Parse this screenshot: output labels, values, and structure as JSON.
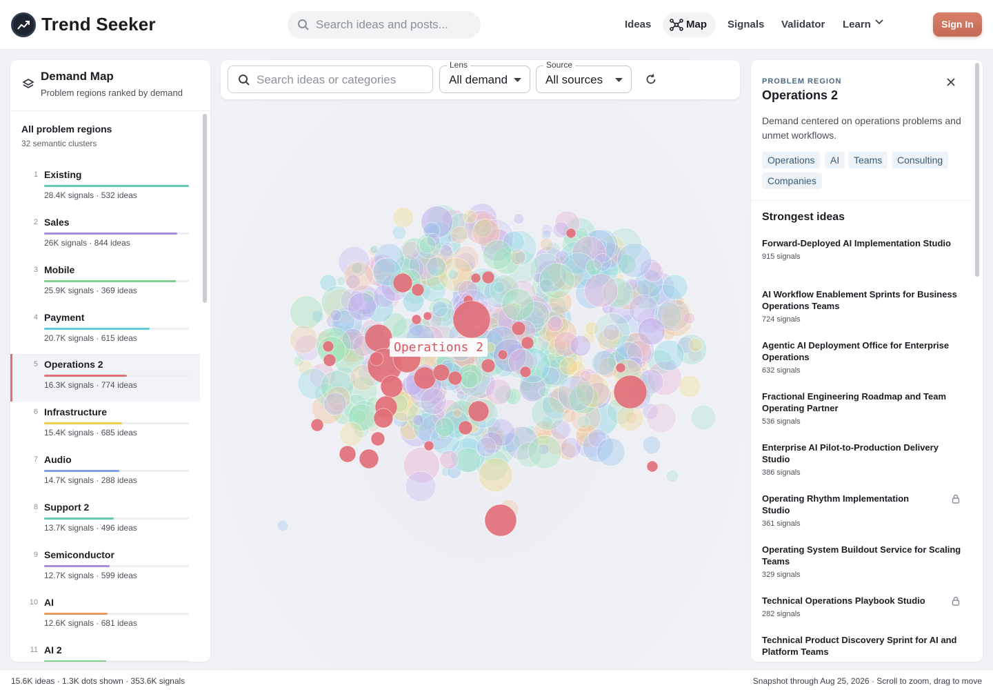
{
  "app": {
    "brand": "Trend Seeker"
  },
  "top_search": {
    "placeholder": "Search ideas and posts..."
  },
  "nav": [
    {
      "label": "Ideas"
    },
    {
      "label": "Map",
      "active": true
    },
    {
      "label": "Signals"
    },
    {
      "label": "Validator"
    },
    {
      "label": "Learn"
    }
  ],
  "signin_label": "Sign In",
  "left_panel": {
    "title": "Demand Map",
    "subtitle": "Problem regions ranked by demand",
    "all_label": "All problem regions",
    "cluster_count": "32 semantic clusters",
    "regions": [
      {
        "rank": "1",
        "name": "Existing",
        "stats": "28.4K signals · 532 ideas",
        "level": 1.0,
        "color": "#5fcdb6"
      },
      {
        "rank": "2",
        "name": "Sales",
        "stats": "26K signals · 844 ideas",
        "level": 0.92,
        "color": "#a98be0"
      },
      {
        "rank": "3",
        "name": "Mobile",
        "stats": "25.9K signals · 369 ideas",
        "level": 0.91,
        "color": "#7fd08a"
      },
      {
        "rank": "4",
        "name": "Payment",
        "stats": "20.7K signals · 615 ideas",
        "level": 0.73,
        "color": "#63c9d9"
      },
      {
        "rank": "5",
        "name": "Operations 2",
        "stats": "16.3K signals · 774 ideas",
        "level": 0.57,
        "color": "#e2707a",
        "active": true
      },
      {
        "rank": "6",
        "name": "Infrastructure",
        "stats": "15.4K signals · 685 ideas",
        "level": 0.54,
        "color": "#f0cf4f"
      },
      {
        "rank": "7",
        "name": "Audio",
        "stats": "14.7K signals · 288 ideas",
        "level": 0.52,
        "color": "#7ea1e5"
      },
      {
        "rank": "8",
        "name": "Support 2",
        "stats": "13.7K signals · 496 ideas",
        "level": 0.48,
        "color": "#5fcdb6"
      },
      {
        "rank": "9",
        "name": "Semiconductor",
        "stats": "12.7K signals · 599 ideas",
        "level": 0.45,
        "color": "#a98be0"
      },
      {
        "rank": "10",
        "name": "AI",
        "stats": "12.6K signals · 681 ideas",
        "level": 0.44,
        "color": "#e89a5a"
      },
      {
        "rank": "11",
        "name": "AI 2",
        "stats": "",
        "level": 0.43,
        "color": "#7fd08a"
      }
    ]
  },
  "toolbar": {
    "search_placeholder": "Search ideas or categories",
    "lens_label": "Lens",
    "lens_value": "All demand",
    "source_label": "Source",
    "source_value": "All sources"
  },
  "map": {
    "selected_label": "Operations 2"
  },
  "right_panel": {
    "kicker": "PROBLEM REGION",
    "title": "Operations 2",
    "description": "Demand centered on operations problems and unmet workflows.",
    "tags": [
      "Operations",
      "AI",
      "Teams",
      "Consulting",
      "Companies"
    ],
    "strongest_heading": "Strongest ideas",
    "ideas": [
      {
        "title": "Forward-Deployed AI Implementation Studio",
        "signals": "915 signals",
        "locked": false
      },
      {
        "title": "AI Workflow Enablement Sprints for Business Operations Teams",
        "signals": "724 signals",
        "locked": false
      },
      {
        "title": "Agentic AI Deployment Office for Enterprise Operations",
        "signals": "632 signals",
        "locked": false
      },
      {
        "title": "Fractional Engineering Roadmap and Team Operating Partner",
        "signals": "536 signals",
        "locked": false
      },
      {
        "title": "Enterprise AI Pilot-to-Production Delivery Studio",
        "signals": "386 signals",
        "locked": false
      },
      {
        "title": "Operating Rhythm Implementation Studio",
        "signals": "361 signals",
        "locked": true
      },
      {
        "title": "Operating System Buildout Service for Scaling Teams",
        "signals": "329 signals",
        "locked": false
      },
      {
        "title": "Technical Operations Playbook Studio",
        "signals": "282 signals",
        "locked": true
      },
      {
        "title": "Technical Product Discovery Sprint for AI and Platform Teams",
        "signals": "",
        "locked": false
      }
    ]
  },
  "status": {
    "left": "15.6K ideas · 1.3K dots shown · 353.6K signals",
    "right": "Snapshot through Aug 25, 2026 · Scroll to zoom, drag to move"
  },
  "colors": {
    "accent": "#e2707a",
    "signin": "#c96b56",
    "tag_text": "#3c5a7a"
  }
}
